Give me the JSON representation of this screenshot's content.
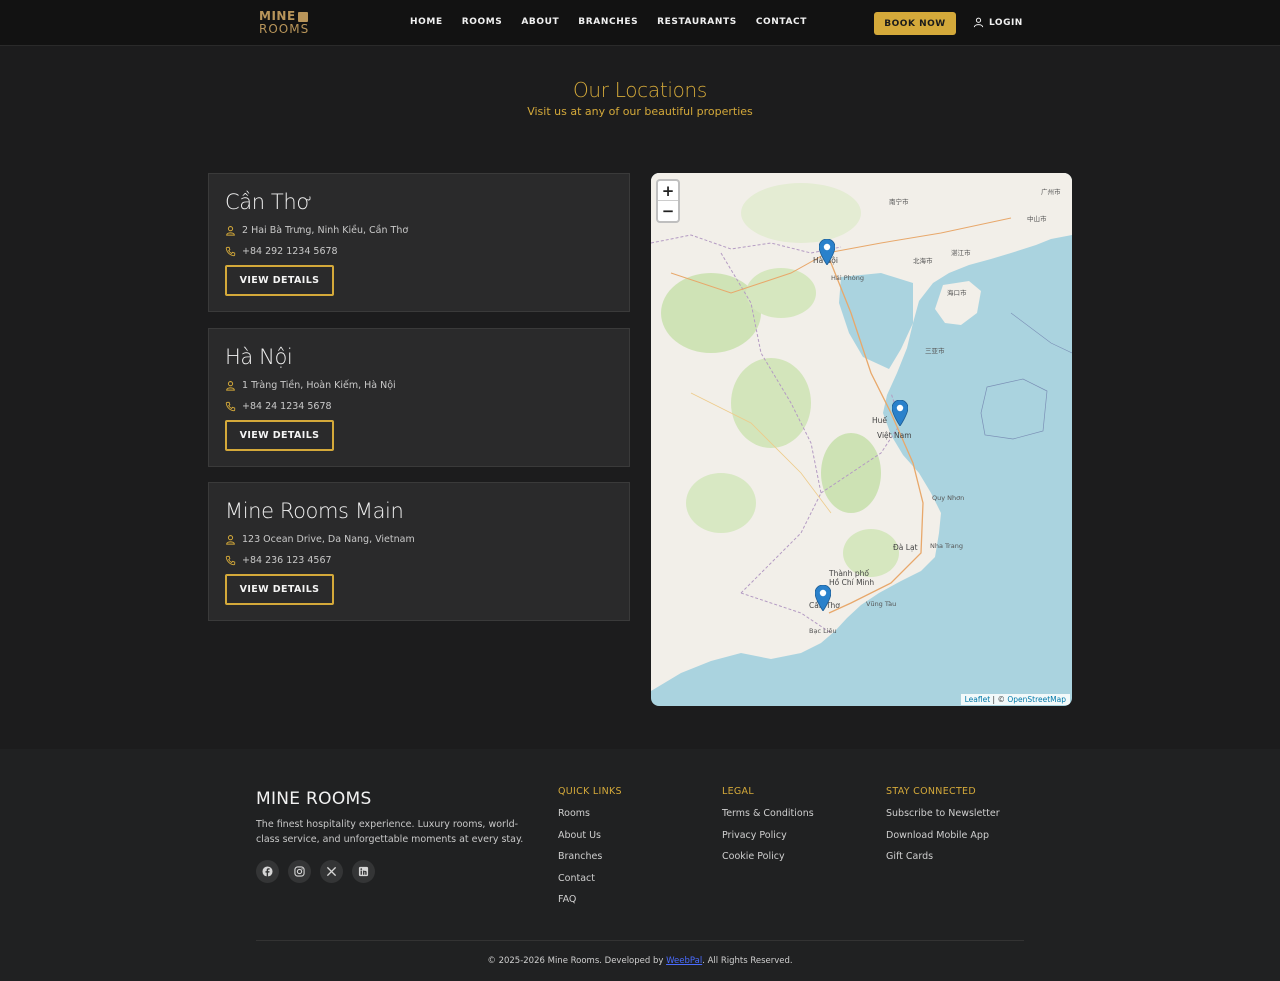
{
  "brand": {
    "line1": "MINE",
    "line2": "ROOMS"
  },
  "nav": {
    "items": [
      "HOME",
      "ROOMS",
      "ABOUT",
      "BRANCHES",
      "RESTAURANTS",
      "CONTACT"
    ],
    "book_label": "BOOK NOW",
    "login_label": "LOGIN"
  },
  "hero": {
    "title": "Our Locations",
    "subtitle": "Visit us at any of our beautiful properties"
  },
  "locations": [
    {
      "name": "Cần Thơ",
      "address": "2 Hai Bà Trưng, Ninh Kiều, Cần Thơ",
      "phone": "+84 292 1234 5678",
      "button": "VIEW DETAILS"
    },
    {
      "name": "Hà Nội",
      "address": "1 Tràng Tiền, Hoàn Kiếm, Hà Nội",
      "phone": "+84 24 1234 5678",
      "button": "VIEW DETAILS"
    },
    {
      "name": "Mine Rooms Main",
      "address": "123 Ocean Drive, Da Nang, Vietnam",
      "phone": "+84 236 123 4567",
      "button": "VIEW DETAILS"
    }
  ],
  "map": {
    "zoom_in": "+",
    "zoom_out": "−",
    "attribution_leaflet": "Leaflet",
    "attribution_sep": " | © ",
    "attribution_osm": "OpenStreetMap",
    "labels": [
      "Hà Nội",
      "Hải Phòng",
      "Huế",
      "Việt Nam",
      "Quy Nhơn",
      "Đà Lạt",
      "Nha Trang",
      "Thành phố Hồ Chí Minh",
      "Cần Thơ",
      "Vũng Tàu",
      "Bạc Liêu",
      "海口市",
      "三亚市",
      "南宁市",
      "北海市",
      "湛江市",
      "中山市",
      "广州市"
    ]
  },
  "footer": {
    "brand": "MINE ROOMS",
    "description": "The finest hospitality experience. Luxury rooms, world-class service, and unforgettable moments at every stay.",
    "socials": [
      "facebook-icon",
      "instagram-icon",
      "x-icon",
      "linkedin-icon"
    ],
    "quick_links": {
      "title": "QUICK LINKS",
      "items": [
        "Rooms",
        "About Us",
        "Branches",
        "Contact",
        "FAQ"
      ]
    },
    "legal": {
      "title": "LEGAL",
      "items": [
        "Terms & Conditions",
        "Privacy Policy",
        "Cookie Policy"
      ]
    },
    "stay_connected": {
      "title": "STAY CONNECTED",
      "items": [
        "Subscribe to Newsletter",
        "Download Mobile App",
        "Gift Cards"
      ]
    },
    "copyright_pre": "© 2025-2026 Mine Rooms. Developed by ",
    "developer": "WeebPal",
    "copyright_post": ". All Rights Reserved."
  },
  "colors": {
    "accent": "#d4a93a",
    "background": "#1c1c1d",
    "card": "#2a2a2b",
    "water": "#aad3df",
    "land": "#f2efe9"
  }
}
